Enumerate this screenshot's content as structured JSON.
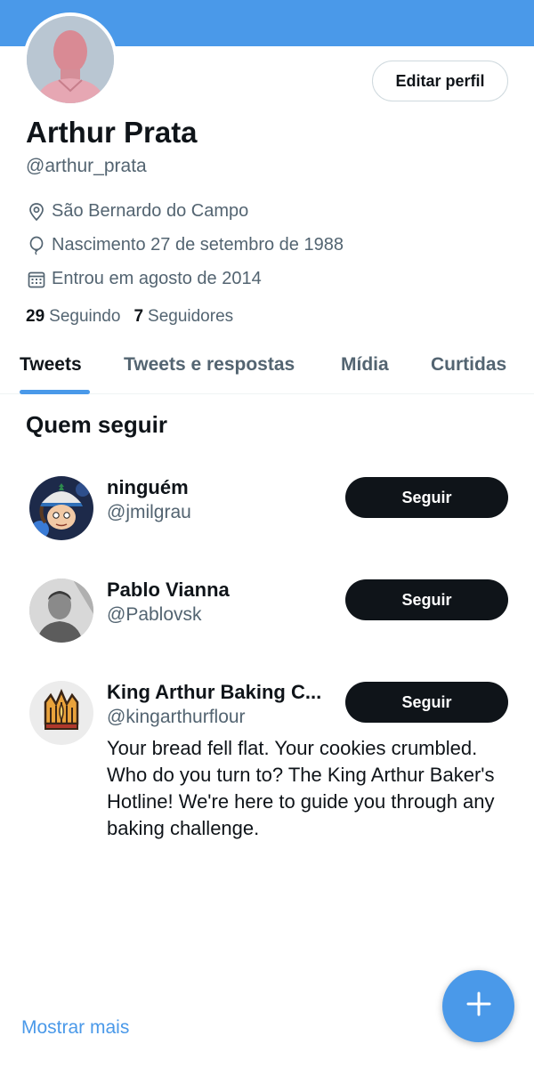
{
  "profile": {
    "name": "Arthur Prata",
    "handle": "@arthur_prata",
    "location": "São Bernardo do Campo",
    "birth": "Nascimento 27 de setembro de 1988",
    "joined": "Entrou em agosto de 2014",
    "following_count": "29",
    "following_label": "Seguindo",
    "followers_count": "7",
    "followers_label": "Seguidores",
    "edit_label": "Editar perfil"
  },
  "tabs": [
    {
      "label": "Tweets",
      "active": true
    },
    {
      "label": "Tweets e respostas",
      "active": false
    },
    {
      "label": "Mídia",
      "active": false
    },
    {
      "label": "Curtidas",
      "active": false
    }
  ],
  "who_to_follow": {
    "title": "Quem seguir",
    "items": [
      {
        "name": "ninguém",
        "handle": "@jmilgrau",
        "button": "Seguir",
        "bio": ""
      },
      {
        "name": "Pablo Vianna",
        "handle": "@Pablovsk",
        "button": "Seguir",
        "bio": ""
      },
      {
        "name": "King Arthur Baking C...",
        "handle": "@kingarthurflour",
        "button": "Seguir",
        "bio": "Your bread fell flat. Your cookies crumbled. Who do you turn to? The King Arthur Baker's Hotline! We're here to guide you through any baking challenge."
      }
    ],
    "show_more": "Mostrar mais"
  },
  "icons": {
    "location": "location-pin-icon",
    "birth": "balloon-icon",
    "joined": "calendar-icon",
    "compose": "plus-icon"
  },
  "colors": {
    "accent": "#4a99e9",
    "primary_text": "#0f1419",
    "secondary_text": "#536471",
    "button_dark": "#0f1419"
  }
}
